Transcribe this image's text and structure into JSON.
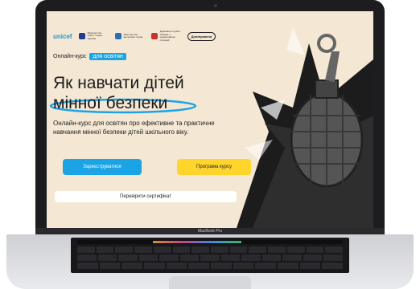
{
  "device": {
    "brand_label": "MacBook Pro"
  },
  "header": {
    "logos": [
      {
        "name": "unicef",
        "text": "unicef"
      },
      {
        "name": "ministry-education",
        "text": "Міністерство освіти і науки України"
      },
      {
        "name": "ministry-internal",
        "text": "Міністерство внутрішніх справ"
      },
      {
        "name": "state-emergency",
        "text": "Державна служба України з надзвичайних ситуацій"
      },
      {
        "name": "partner-pill",
        "text": "Демінування"
      }
    ]
  },
  "course": {
    "prefix": "Онлайн-курс",
    "badge": "для освітян",
    "title_line1": "Як навчати дітей",
    "title_line2": "мінної безпеки",
    "description": "Онлайн-курс для освітян про ефективне та практичне навчання мінної безпеки дітей шкільного віку."
  },
  "actions": {
    "register_label": "Зареєструватися",
    "program_label": "Програма курсу",
    "certificate_label": "Перевірити сертифікат"
  },
  "colors": {
    "accent_blue": "#1aa4e6",
    "accent_yellow": "#ffd52b",
    "background": "#f4e7d3"
  }
}
